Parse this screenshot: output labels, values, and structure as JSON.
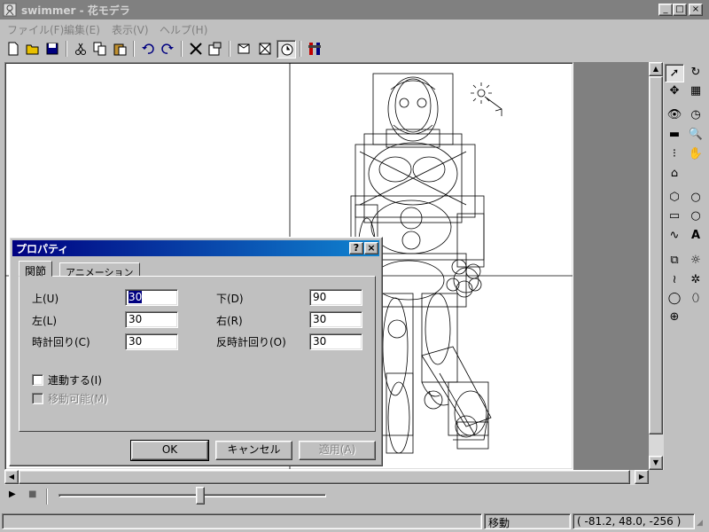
{
  "window": {
    "title": "swimmer - 花モデラ"
  },
  "caption_buttons": {
    "minimize": "_",
    "maximize": "□",
    "close": "×"
  },
  "menu": [
    "ファイル(F)",
    "編集(E)",
    "表示(V)",
    "ヘルプ(H)"
  ],
  "toolbar": [
    "new-file",
    "open-folder",
    "save",
    "cut",
    "copy",
    "paste",
    "undo",
    "redo",
    "delete",
    "properties",
    "view-front",
    "view-frame",
    "clock",
    "tools"
  ],
  "palette": [
    "arrow",
    "rotate",
    "move",
    "grid",
    "eye",
    "compass",
    "ground",
    "magnifier",
    "joint",
    "hand",
    "home",
    "cube",
    "circle",
    "rectangle",
    "circle",
    "curve",
    "text",
    "camera",
    "sun",
    "spring",
    "spread",
    "sphere",
    "ellipse",
    "plus"
  ],
  "palette_text": {
    "text_tool": "A"
  },
  "dialog": {
    "title": "プロパティ",
    "help_label": "?",
    "close_label": "×",
    "tabs": [
      "関節",
      "アニメーション"
    ],
    "fields": {
      "up_label": "上(U)",
      "up_value": "30",
      "down_label": "下(D)",
      "down_value": "90",
      "left_label": "左(L)",
      "left_value": "30",
      "right_label": "右(R)",
      "right_value": "30",
      "cw_label": "時計回り(C)",
      "cw_value": "30",
      "ccw_label": "反時計回り(O)",
      "ccw_value": "30"
    },
    "check_link": "連動する(I)",
    "check_movable": "移動可能(M)",
    "ok": "OK",
    "cancel": "キャンセル",
    "apply": "適用(A)"
  },
  "status": {
    "mode": "移動",
    "coords": "( -81.2, 48.0, -256 )"
  },
  "timeline": {
    "position": 0.53
  },
  "colors": {
    "titlebar_active": "#000080",
    "titlebar_inactive": "#808080",
    "face": "#c0c0c0"
  }
}
